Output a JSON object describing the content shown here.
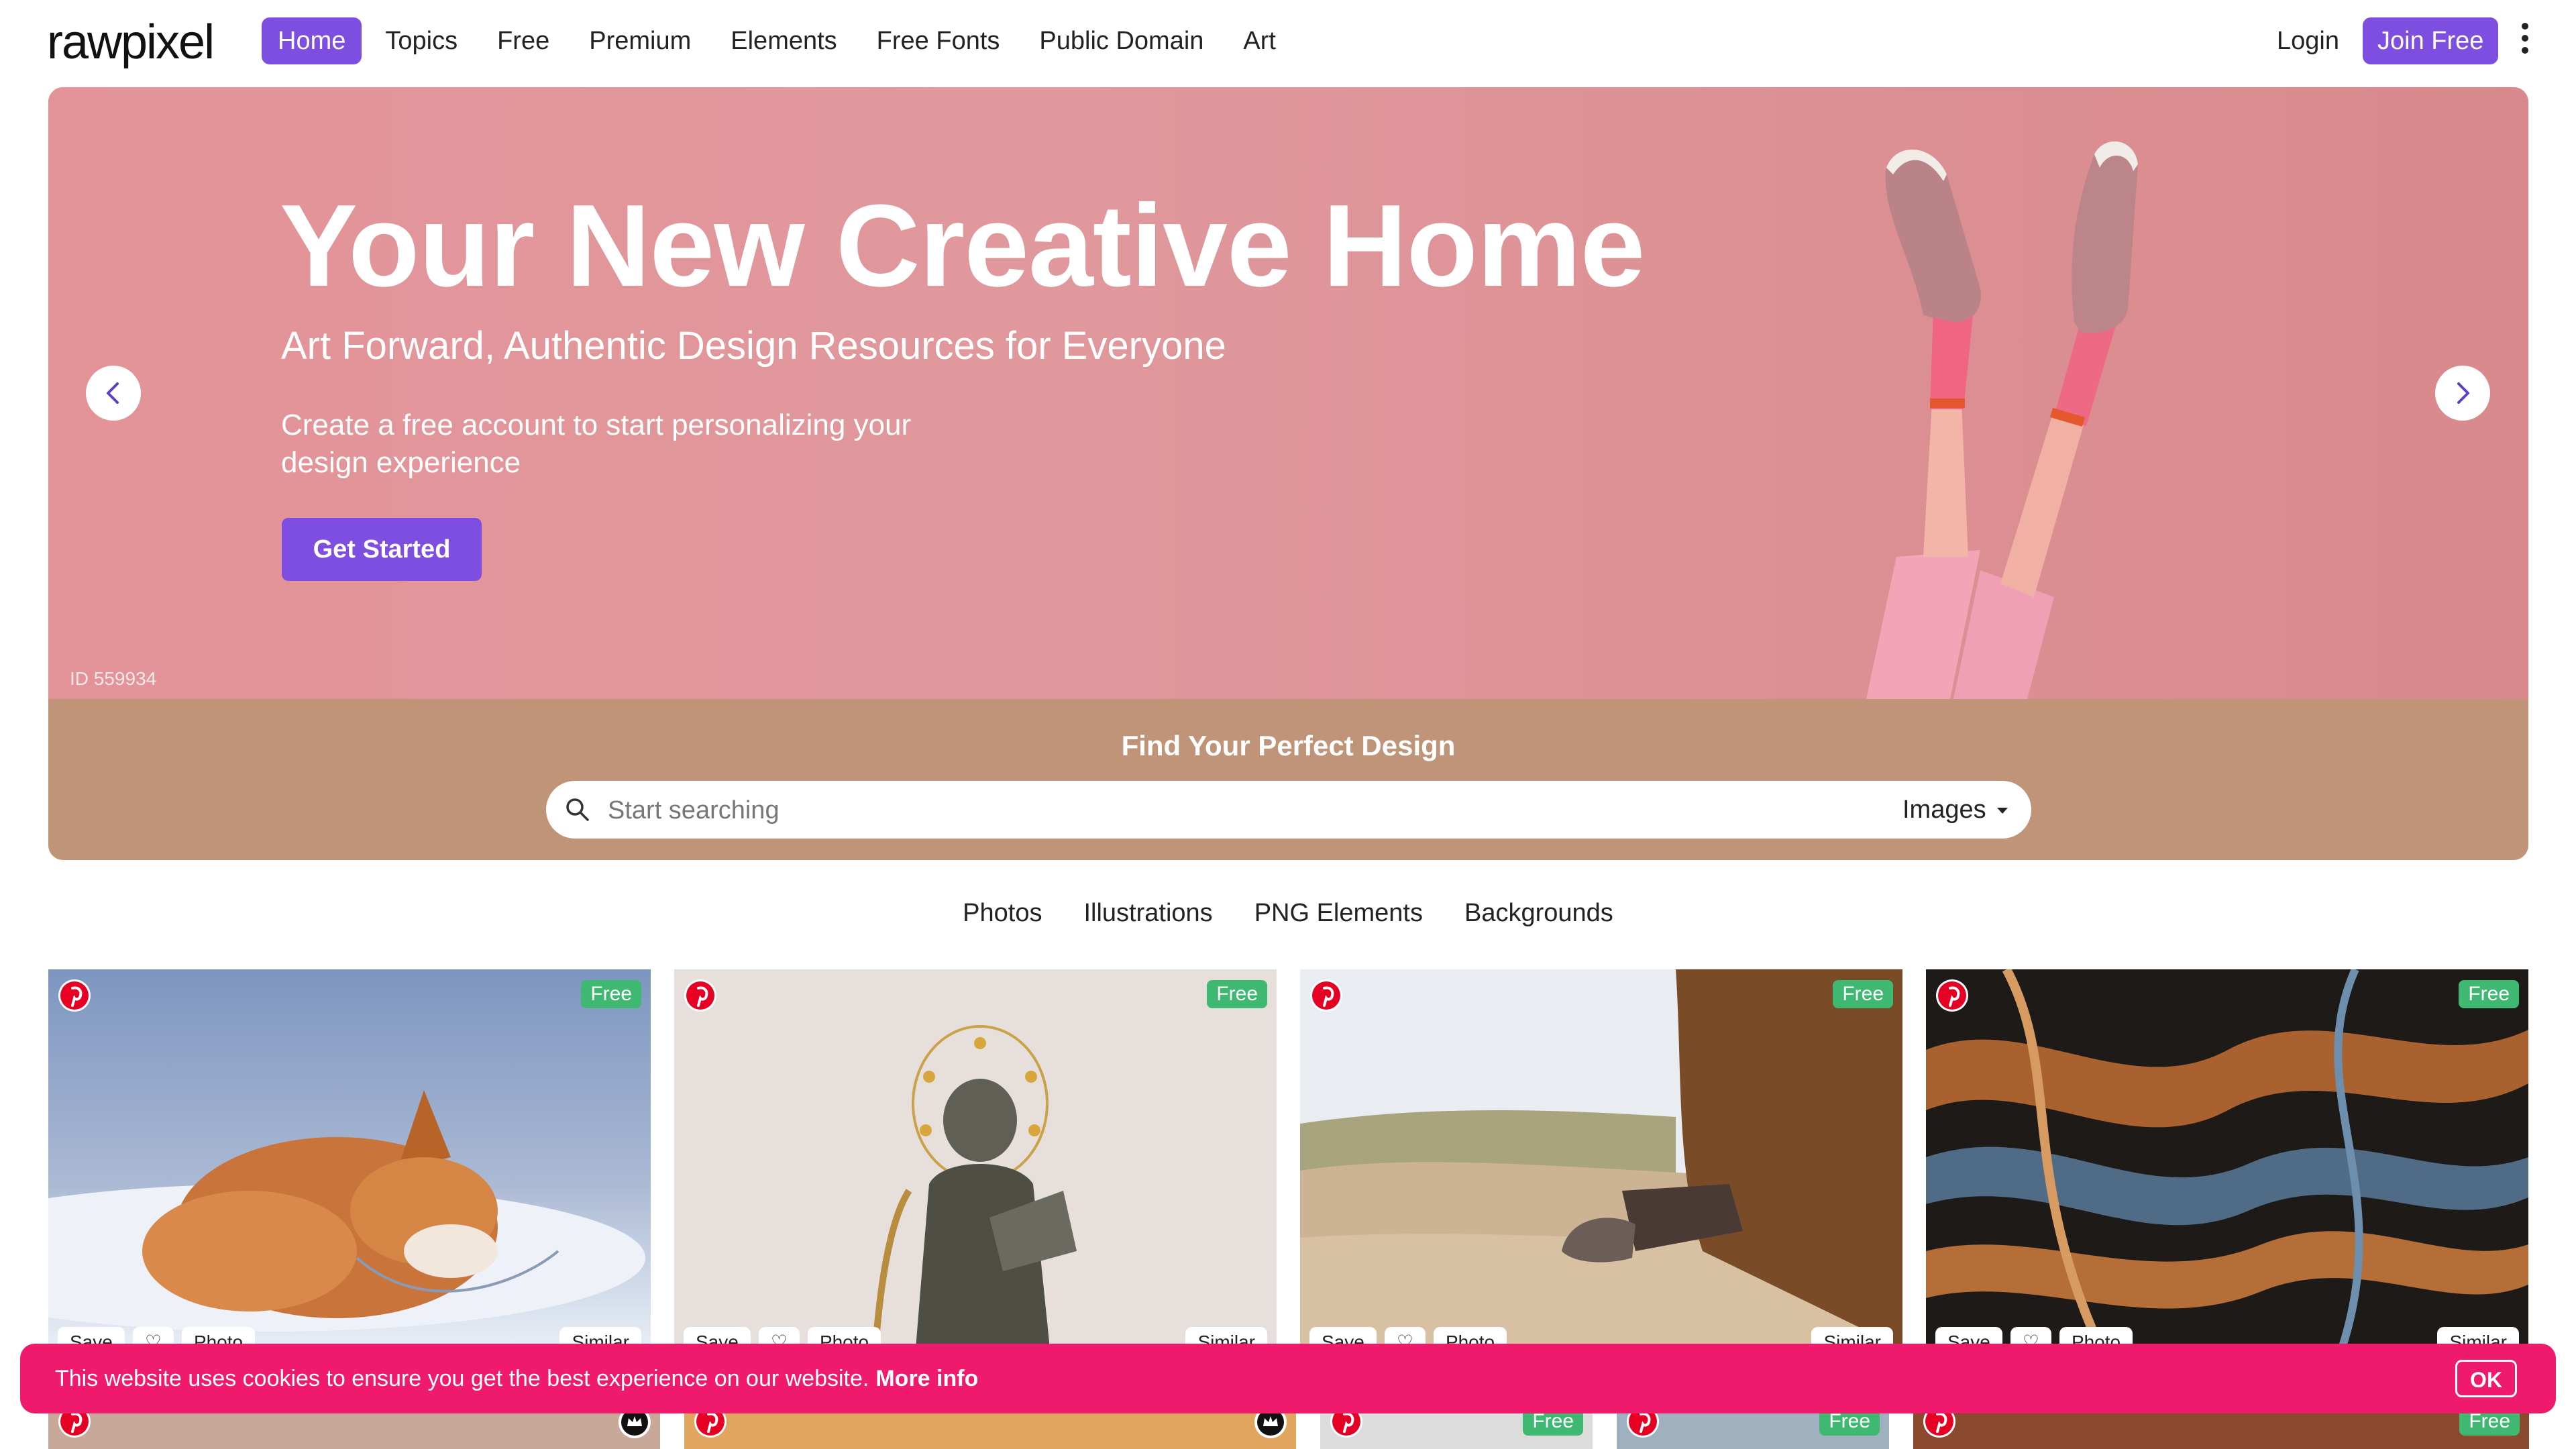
{
  "nav": {
    "logo": "rawpixel",
    "links": [
      "Home",
      "Topics",
      "Free",
      "Premium",
      "Elements",
      "Free Fonts",
      "Public Domain",
      "Art"
    ],
    "active": "Home",
    "login": "Login",
    "join": "Join Free"
  },
  "hero": {
    "title": "Your New Creative Home",
    "subtitle": "Art Forward, Authentic Design Resources for Everyone",
    "description": "Create a free account to start personalizing your design experience",
    "cta": "Get Started",
    "image_id": "ID 559934"
  },
  "search": {
    "title": "Find Your Perfect Design",
    "placeholder": "Start searching",
    "type": "Images"
  },
  "categories": [
    "Photos",
    "Illustrations",
    "PNG Elements",
    "Backgrounds"
  ],
  "cards": [
    {
      "badge": "Free",
      "save": "Save",
      "type": "Photo",
      "similar": "Similar"
    },
    {
      "badge": "Free",
      "save": "Save",
      "type": "Photo",
      "similar": "Similar"
    },
    {
      "badge": "Free",
      "save": "Save",
      "type": "Photo",
      "similar": "Similar"
    },
    {
      "badge": "Free",
      "save": "Save",
      "type": "Photo",
      "similar": "Similar"
    }
  ],
  "row2": [
    {
      "badge": ""
    },
    {
      "badge": ""
    },
    {
      "badge": "Free"
    },
    {
      "badge": "Free"
    },
    {
      "badge": "Free"
    }
  ],
  "cookie": {
    "text": "This website uses cookies to ensure you get the best experience on our website.",
    "more": "More info",
    "ok": "OK"
  },
  "colors": {
    "accent": "#7e4ee0",
    "hero_pink": "#e0989c",
    "search_band": "#bf9479",
    "free_badge": "#3fb872",
    "cookie": "#ef1a6c",
    "pinterest": "#e60023"
  }
}
